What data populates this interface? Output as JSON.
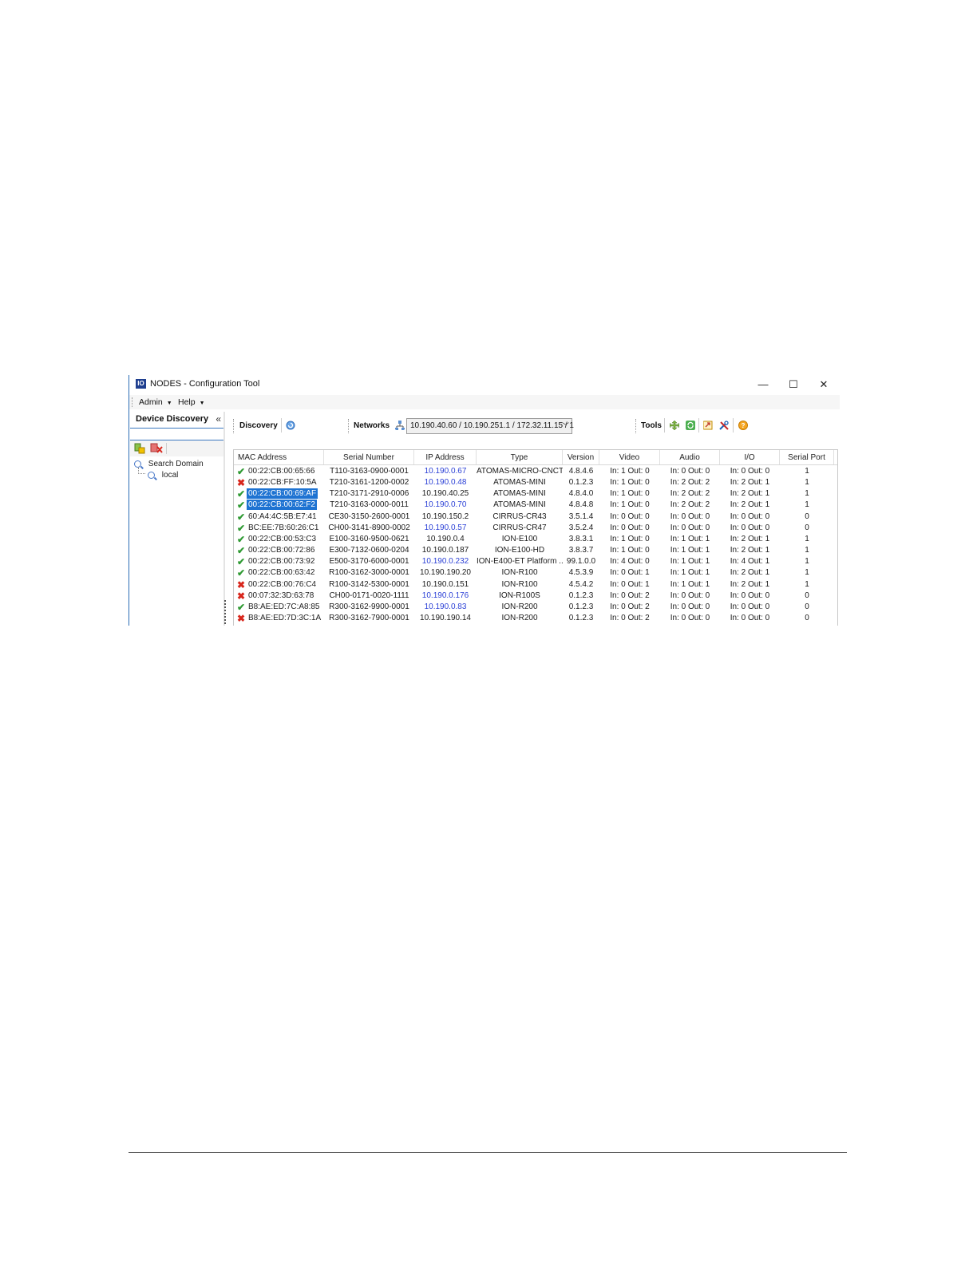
{
  "window": {
    "title": "NODES - Configuration Tool",
    "logo_text": "IO",
    "controls": {
      "minimize": "—",
      "maximize": "☐",
      "close": "✕"
    }
  },
  "menu": {
    "items": [
      {
        "label": "Admin"
      },
      {
        "label": "Help"
      }
    ]
  },
  "left_panel": {
    "title": "Device Discovery",
    "collapse_glyph": "«",
    "tree": {
      "root": "Search Domain",
      "child": "local"
    }
  },
  "toolbar": {
    "discovery_label": "Discovery",
    "networks_label": "Networks",
    "networks_value": "10.190.40.60 / 10.190.251.1 / 172.32.11.15 / 1",
    "tools_label": "Tools"
  },
  "grid": {
    "columns": [
      "MAC Address",
      "Serial Number",
      "IP Address",
      "Type",
      "Version",
      "Video",
      "Audio",
      "I/O",
      "Serial Port"
    ],
    "rows": [
      {
        "status": "ok",
        "mac": "00:22:CB:00:65:66",
        "serial": "T110-3163-0900-0001",
        "ip": "10.190.0.67",
        "ip_link": true,
        "type": "ATOMAS-MICRO-CNCT",
        "version": "4.8.4.6",
        "video": "In: 1  Out: 0",
        "audio": "In: 0  Out: 0",
        "io": "In: 0  Out: 0",
        "serial_port": "1",
        "selected": false
      },
      {
        "status": "err",
        "mac": "00:22:CB:FF:10:5A",
        "serial": "T210-3161-1200-0002",
        "ip": "10.190.0.48",
        "ip_link": true,
        "type": "ATOMAS-MINI",
        "version": "0.1.2.3",
        "video": "In: 1  Out: 0",
        "audio": "In: 2  Out: 2",
        "io": "In: 2  Out: 1",
        "serial_port": "1",
        "selected": false
      },
      {
        "status": "ok",
        "mac": "00:22:CB:00:69:AF",
        "serial": "T210-3171-2910-0006",
        "ip": "10.190.40.25",
        "ip_link": false,
        "type": "ATOMAS-MINI",
        "version": "4.8.4.0",
        "video": "In: 1  Out: 0",
        "audio": "In: 2  Out: 2",
        "io": "In: 2  Out: 1",
        "serial_port": "1",
        "selected": true
      },
      {
        "status": "ok",
        "mac": "00:22:CB:00:62:F2",
        "serial": "T210-3163-0000-0011",
        "ip": "10.190.0.70",
        "ip_link": true,
        "type": "ATOMAS-MINI",
        "version": "4.8.4.8",
        "video": "In: 1  Out: 0",
        "audio": "In: 2  Out: 2",
        "io": "In: 2  Out: 1",
        "serial_port": "1",
        "selected": true
      },
      {
        "status": "ok",
        "mac": "60:A4:4C:5B:E7:41",
        "serial": "CE30-3150-2600-0001",
        "ip": "10.190.150.2",
        "ip_link": false,
        "type": "CIRRUS-CR43",
        "version": "3.5.1.4",
        "video": "In: 0  Out: 0",
        "audio": "In: 0  Out: 0",
        "io": "In: 0  Out: 0",
        "serial_port": "0",
        "selected": false
      },
      {
        "status": "ok",
        "mac": "BC:EE:7B:60:26:C1",
        "serial": "CH00-3141-8900-0002",
        "ip": "10.190.0.57",
        "ip_link": true,
        "type": "CIRRUS-CR47",
        "version": "3.5.2.4",
        "video": "In: 0  Out: 0",
        "audio": "In: 0  Out: 0",
        "io": "In: 0  Out: 0",
        "serial_port": "0",
        "selected": false
      },
      {
        "status": "ok",
        "mac": "00:22:CB:00:53:C3",
        "serial": "E100-3160-9500-0621",
        "ip": "10.190.0.4",
        "ip_link": false,
        "type": "ION-E100",
        "version": "3.8.3.1",
        "video": "In: 1  Out: 0",
        "audio": "In: 1  Out: 1",
        "io": "In: 2  Out: 1",
        "serial_port": "1",
        "selected": false
      },
      {
        "status": "ok",
        "mac": "00:22:CB:00:72:86",
        "serial": "E300-7132-0600-0204",
        "ip": "10.190.0.187",
        "ip_link": false,
        "type": "ION-E100-HD",
        "version": "3.8.3.7",
        "video": "In: 1  Out: 0",
        "audio": "In: 1  Out: 1",
        "io": "In: 2  Out: 1",
        "serial_port": "1",
        "selected": false
      },
      {
        "status": "ok",
        "mac": "00:22:CB:00:73:92",
        "serial": "E500-3170-6000-0001",
        "ip": "10.190.0.232",
        "ip_link": true,
        "type": "ION-E400-ET Platform ...",
        "version": "99.1.0.0",
        "video": "In: 4  Out: 0",
        "audio": "In: 1  Out: 1",
        "io": "In: 4  Out: 1",
        "serial_port": "1",
        "selected": false
      },
      {
        "status": "ok",
        "mac": "00:22:CB:00:63:42",
        "serial": "R100-3162-3000-0001",
        "ip": "10.190.190.20",
        "ip_link": false,
        "type": "ION-R100",
        "version": "4.5.3.9",
        "video": "In: 0  Out: 1",
        "audio": "In: 1  Out: 1",
        "io": "In: 2  Out: 1",
        "serial_port": "1",
        "selected": false
      },
      {
        "status": "err",
        "mac": "00:22:CB:00:76:C4",
        "serial": "R100-3142-5300-0001",
        "ip": "10.190.0.151",
        "ip_link": false,
        "type": "ION-R100",
        "version": "4.5.4.2",
        "video": "In: 0  Out: 1",
        "audio": "In: 1  Out: 1",
        "io": "In: 2  Out: 1",
        "serial_port": "1",
        "selected": false
      },
      {
        "status": "err",
        "mac": "00:07:32:3D:63:78",
        "serial": "CH00-0171-0020-1111",
        "ip": "10.190.0.176",
        "ip_link": true,
        "type": "ION-R100S",
        "version": "0.1.2.3",
        "video": "In: 0  Out: 2",
        "audio": "In: 0  Out: 0",
        "io": "In: 0  Out: 0",
        "serial_port": "0",
        "selected": false
      },
      {
        "status": "ok",
        "mac": "B8:AE:ED:7C:A8:85",
        "serial": "R300-3162-9900-0001",
        "ip": "10.190.0.83",
        "ip_link": true,
        "type": "ION-R200",
        "version": "0.1.2.3",
        "video": "In: 0  Out: 2",
        "audio": "In: 0  Out: 0",
        "io": "In: 0  Out: 0",
        "serial_port": "0",
        "selected": false
      },
      {
        "status": "err",
        "mac": "B8:AE:ED:7D:3C:1A",
        "serial": "R300-3162-7900-0001",
        "ip": "10.190.190.14",
        "ip_link": false,
        "type": "ION-R200",
        "version": "0.1.2.3",
        "video": "In: 0  Out: 2",
        "audio": "In: 0  Out: 0",
        "io": "In: 0  Out: 0",
        "serial_port": "0",
        "selected": false
      }
    ]
  },
  "colors": {
    "selection": "#1e73d2",
    "link": "#2a3fd6",
    "ok": "#2f9a33",
    "error": "#d8261c",
    "border_accent": "#2c6db5"
  }
}
